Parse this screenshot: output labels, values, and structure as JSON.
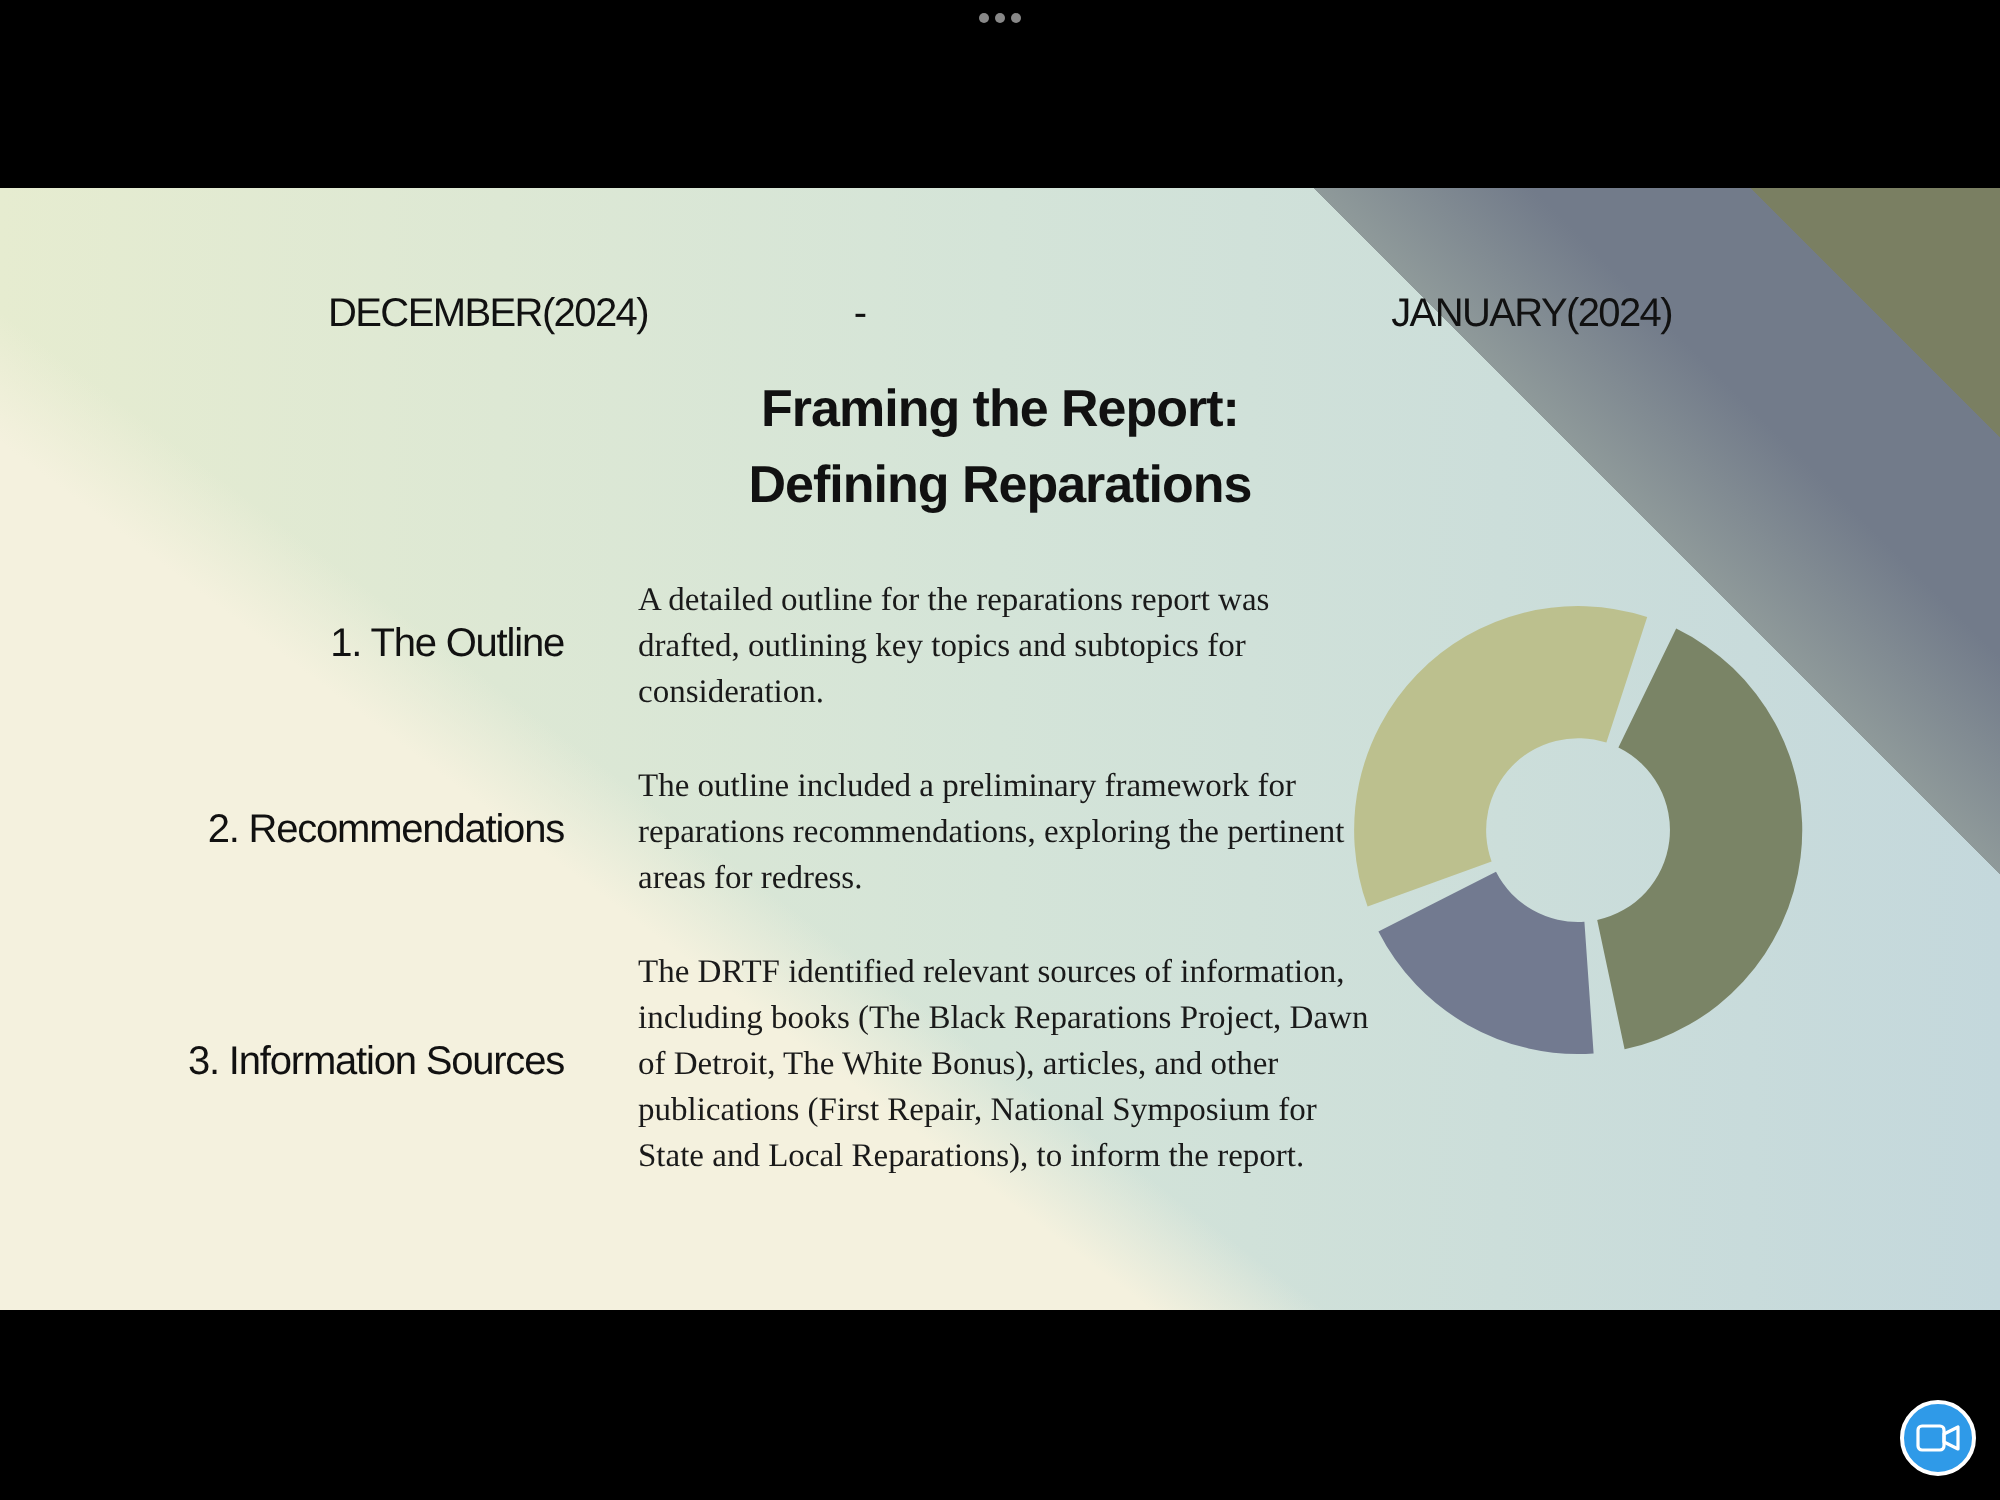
{
  "slide": {
    "date_start": "DECEMBER(2024)",
    "date_separator": "-",
    "date_end": "JANUARY(2024)",
    "title_lines": [
      "Framing the Report:",
      "Defining Reparations"
    ],
    "sections": [
      {
        "heading": "1. The Outline",
        "body": "A detailed outline for the reparations report was drafted, outlining key topics and subtopics for consideration."
      },
      {
        "heading": "2. Recommendations",
        "body": "The outline included a preliminary framework for reparations recommendations, exploring the pertinent areas for redress."
      },
      {
        "heading": "3. Information Sources",
        "body": "The DRTF identified relevant sources of information, including books (The Black Reparations Project, Dawn of Detroit, The White Bonus), articles, and other publications (First Repair, National Symposium for State and Local Reparations), to inform the report."
      }
    ]
  }
}
